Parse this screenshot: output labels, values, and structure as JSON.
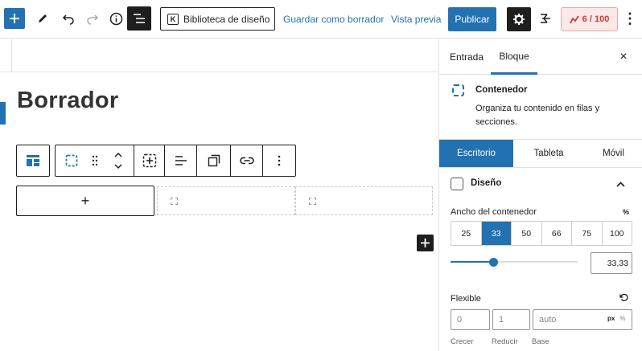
{
  "toolbar": {
    "library_label": "Biblioteca de diseño",
    "save_draft_label": "Guardar como borrador",
    "preview_label": "Vista previa",
    "publish_label": "Publicar",
    "score_label": "6 / 100",
    "icons": [
      "plus-icon",
      "pen-icon",
      "undo-icon",
      "redo-icon",
      "info-icon",
      "list-view-icon",
      "library-icon",
      "gear-icon",
      "kadence-icon",
      "score-icon",
      "more-icon"
    ]
  },
  "editor": {
    "post_title": "Borrador",
    "add_column_label": "+",
    "add_block_label": "+"
  },
  "sidebar": {
    "tabs": [
      {
        "label": "Entrada",
        "active": false
      },
      {
        "label": "Bloque",
        "active": true
      }
    ],
    "close_label": "×",
    "block": {
      "name": "Contenedor",
      "description": "Organiza tu contenido en filas y secciones."
    },
    "devices": [
      {
        "label": "Escritorio",
        "active": true
      },
      {
        "label": "Tableta",
        "active": false
      },
      {
        "label": "Móvil",
        "active": false
      }
    ],
    "design": {
      "title": "Diseño",
      "width_label": "Ancho del contenedor",
      "width_unit": "%",
      "presets": [
        "25",
        "33",
        "50",
        "66",
        "75",
        "100"
      ],
      "active_preset": "33",
      "width_value": "33,33",
      "slider_value_percent": 33.33,
      "flex_label": "Flexible",
      "flex_grow_placeholder": "0",
      "flex_shrink_placeholder": "1",
      "flex_basis_placeholder": "auto",
      "flex_units": [
        "px",
        "%"
      ],
      "flex_active_unit": "px",
      "flex_sub_labels": [
        "Crecer",
        "Reducir",
        "Base"
      ]
    }
  },
  "colors": {
    "accent": "#2271b1",
    "dark": "#1e1e1e",
    "score_bg": "#fbe8e8",
    "score_text": "#d63638"
  }
}
